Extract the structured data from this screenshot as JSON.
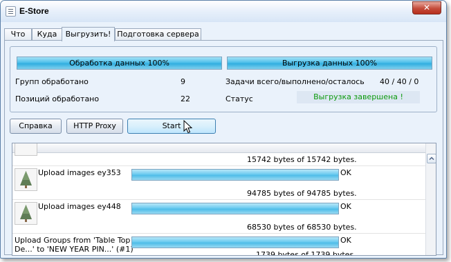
{
  "window": {
    "title": "E-Store",
    "close_glyph": "✕"
  },
  "tabs": [
    {
      "label": "Что"
    },
    {
      "label": "Куда"
    },
    {
      "label": "Выгрузить!"
    },
    {
      "label": "Подготовка сервера"
    }
  ],
  "active_tab": "Выгрузить!",
  "progress": {
    "processing": {
      "label": "Обработка данных  100%",
      "percent": 100
    },
    "upload": {
      "label": "Выгрузка данных  100%",
      "percent": 100
    }
  },
  "stats": {
    "groups_label": "Групп обработано",
    "groups_value": "9",
    "positions_label": "Позиций обработано",
    "positions_value": "22",
    "tasks_label": "Задачи всего/выполнено/осталось",
    "tasks_value": "40 / 40 / 0",
    "status_label": "Статус",
    "status_value": "Выгрузка завершена !"
  },
  "buttons": {
    "help": "Справка",
    "proxy": "HTTP Proxy",
    "start": "Start"
  },
  "log": {
    "partial_bytes": "15742 bytes of 15742 bytes.",
    "rows": [
      {
        "label": "Upload images ey353",
        "status": "OK",
        "bytes": "94785 bytes of 94785 bytes.",
        "percent": 100,
        "icon": "christmas-tree-thumbnail"
      },
      {
        "label": "Upload images ey448",
        "status": "OK",
        "bytes": "68530 bytes of 68530 bytes.",
        "percent": 100,
        "icon": "christmas-tree-thumbnail"
      },
      {
        "label_line1": "Upload Groups from 'Table Top",
        "label_line2": "De...' to 'NEW YEAR PIN...' (#1)",
        "status": "OK",
        "bytes": "1739 bytes of 1739 bytes.",
        "percent": 100
      }
    ]
  },
  "colors": {
    "progress": "#31aee0",
    "status_ok": "#0c9a0c",
    "close": "#c44b3a"
  }
}
